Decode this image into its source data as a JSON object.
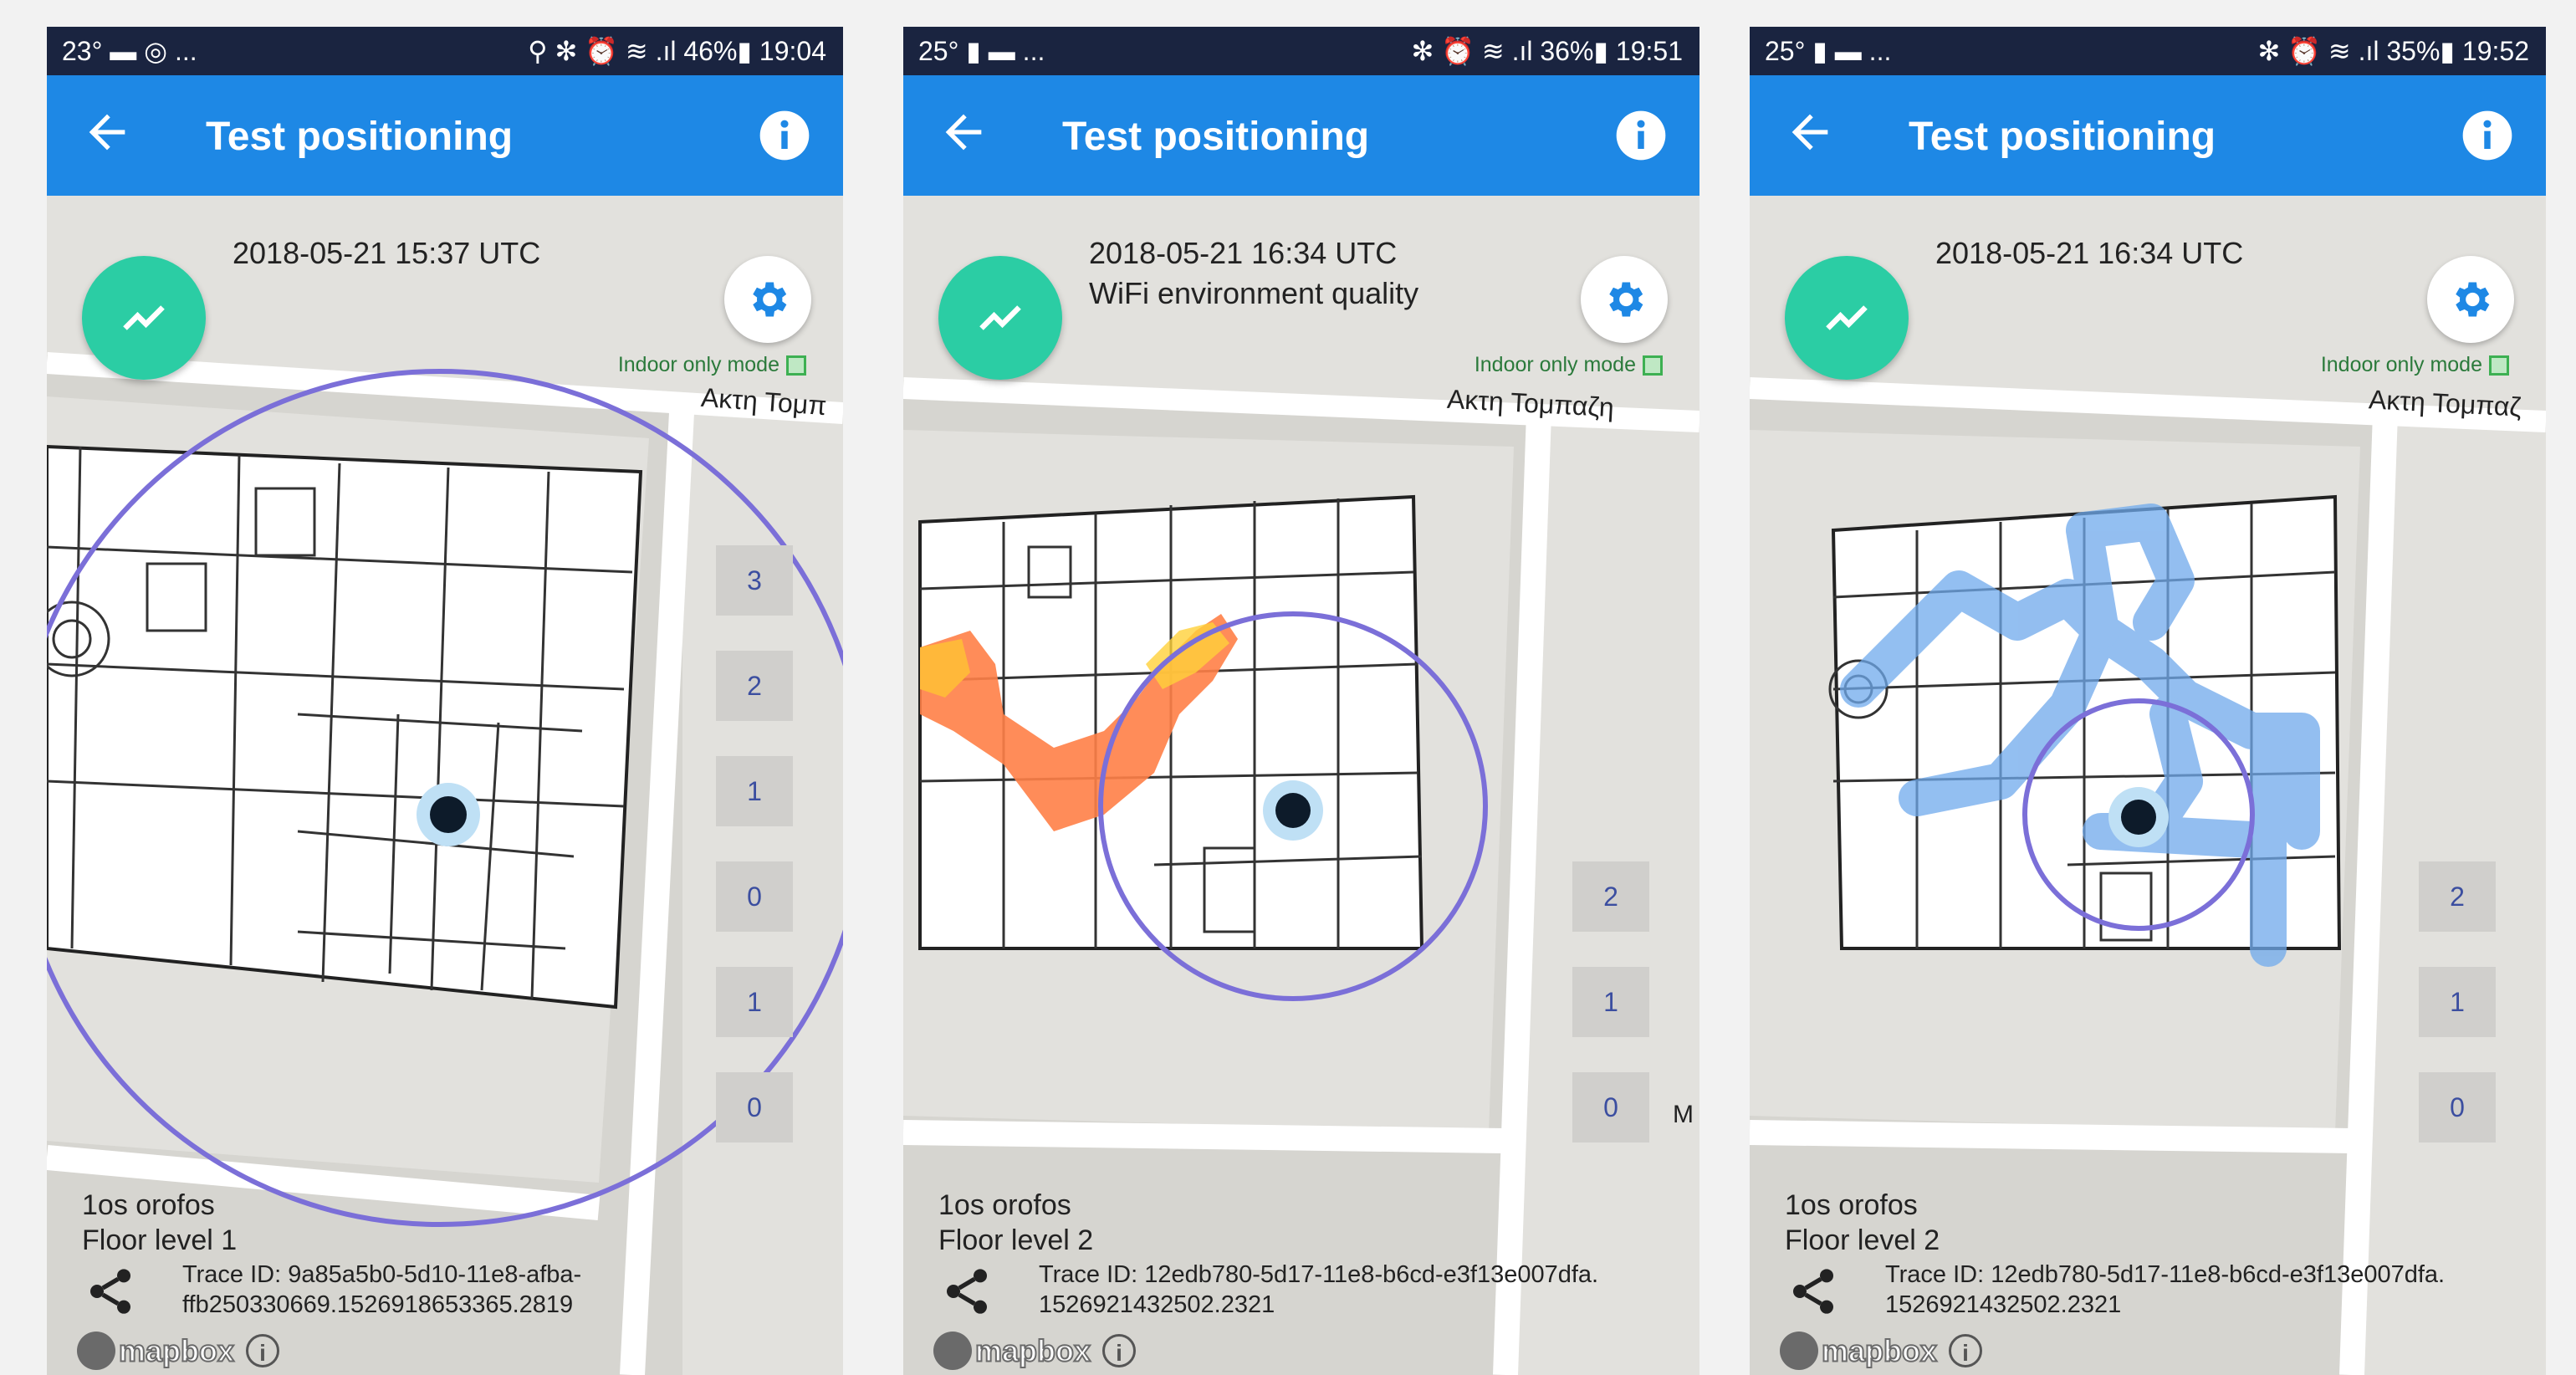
{
  "app": {
    "title": "Test positioning",
    "accent_color": "#1e88e5",
    "fab_color": "#2bcda4",
    "icons": {
      "back": "arrow-left-icon",
      "info": "info-icon",
      "fab": "trend-line-icon",
      "settings": "gear-icon",
      "share": "share-icon",
      "attribution": "info-icon"
    }
  },
  "screens": [
    {
      "status_left": "23° ▬ ◎ ...",
      "status_right": "⚲ ✻ ⏰ ≋ .ıl 46%▮ 19:04",
      "timestamp": "2018-05-21 15:37 UTC",
      "subtitle": "",
      "indoor_mode": "Indoor only mode",
      "street_name": "Ακτη Τομπ",
      "floor_buttons": [
        "3",
        "2",
        "1",
        "0",
        "1",
        "0"
      ],
      "floor_name": "1os orofos",
      "floor_level": "Floor level 1",
      "trace_line1": "Trace ID: 9a85a5b0-5d10-11e8-afba-",
      "trace_line2": "ffb250330669.1526918653365.2819",
      "mapbox": "mapbox"
    },
    {
      "status_left": "25° ▮ ▬ ...",
      "status_right": "✻ ⏰ ≋ .ıl 36%▮ 19:51",
      "timestamp": "2018-05-21 16:34 UTC",
      "subtitle": "WiFi environment quality",
      "indoor_mode": "Indoor only mode",
      "street_name": "Ακτη Τομπαζη",
      "floor_buttons": [
        "2",
        "1",
        "0"
      ],
      "floor_name": "1os orofos",
      "floor_level": "Floor level 2",
      "trace_line1": "Trace ID: 12edb780-5d17-11e8-b6cd-e3f13e007dfa.",
      "trace_line2": "1526921432502.2321",
      "mapbox": "mapbox",
      "edge_label": "M"
    },
    {
      "status_left": "25° ▮ ▬ ...",
      "status_right": "✻ ⏰ ≋ .ıl 35%▮ 19:52",
      "timestamp": "2018-05-21 16:34 UTC",
      "subtitle": "",
      "indoor_mode": "Indoor only mode",
      "street_name": "Ακτη Τομπαζ",
      "floor_buttons": [
        "2",
        "1",
        "0"
      ],
      "floor_name": "1os orofos",
      "floor_level": "Floor level 2",
      "trace_line1": "Trace ID: 12edb780-5d17-11e8-b6cd-e3f13e007dfa.",
      "trace_line2": "1526921432502.2321",
      "mapbox": "mapbox"
    }
  ]
}
